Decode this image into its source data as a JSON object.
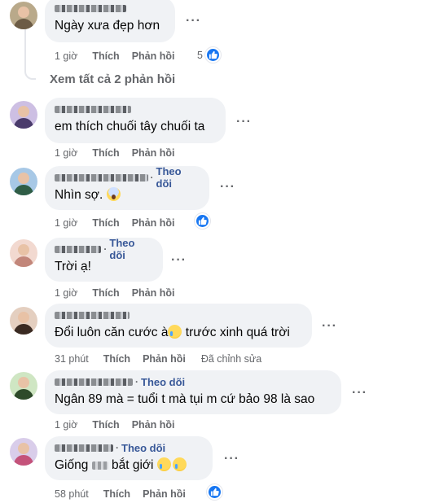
{
  "comments": [
    {
      "text": "Ngày xưa đẹp hơn",
      "time": "1 giờ",
      "like_label": "Thích",
      "reply_label": "Phản hồi",
      "reactions": {
        "icon": "like-icon",
        "count": "5"
      },
      "avatar_colors": [
        "#b9a98a",
        "#6c5b45"
      ]
    },
    {
      "text": "em thích chuối tây chuối ta",
      "time": "1 giờ",
      "like_label": "Thích",
      "reply_label": "Phản hồi",
      "avatar_colors": [
        "#cdbfe3",
        "#4a3b6b"
      ]
    },
    {
      "follow": "Theo dõi",
      "text": "Nhìn sợ. ",
      "emoji": "face-screaming-icon",
      "time": "1 giờ",
      "like_label": "Thích",
      "reply_label": "Phản hồi",
      "reactions": {
        "icon": "like-icon",
        "count": ""
      },
      "avatar_colors": [
        "#a7c8e6",
        "#2f5d46"
      ]
    },
    {
      "follow": "Theo dõi",
      "text": "Trời ạ!",
      "time": "1 giờ",
      "like_label": "Thích",
      "reply_label": "Phản hồi",
      "avatar_colors": [
        "#f2d9d0",
        "#c2867a"
      ]
    },
    {
      "text_before": "Đổi luôn căn cước à",
      "text_after": " trước xinh quá trời",
      "emoji": "crying-face-icon",
      "time": "31 phút",
      "like_label": "Thích",
      "reply_label": "Phản hồi",
      "edited": "Đã chỉnh sửa",
      "avatar_colors": [
        "#e4cfc0",
        "#3a2a22"
      ]
    },
    {
      "follow": "Theo dõi",
      "text": "Ngân 89 mà = tuổi t mà tụi m cứ bảo 98 là sao",
      "time": "1 giờ",
      "like_label": "Thích",
      "reply_label": "Phản hồi",
      "avatar_colors": [
        "#cfe6c3",
        "#2e4a2a"
      ]
    },
    {
      "follow": "Theo dõi",
      "text_before": "Giống ",
      "text_after": " bắt giới ",
      "emoji": "crying-face-icon",
      "time": "58 phút",
      "like_label": "Thích",
      "reply_label": "Phản hồi",
      "reactions": {
        "icon": "like-icon",
        "count": ""
      },
      "avatar_colors": [
        "#d9cdea",
        "#c4527a"
      ]
    }
  ],
  "view_replies": "Xem tất cả 2 phản hồi",
  "more_glyph": "···",
  "colors": {
    "like": "#1877f2",
    "follow": "#385898",
    "bubble": "#f0f2f5",
    "meta": "#65676b"
  }
}
